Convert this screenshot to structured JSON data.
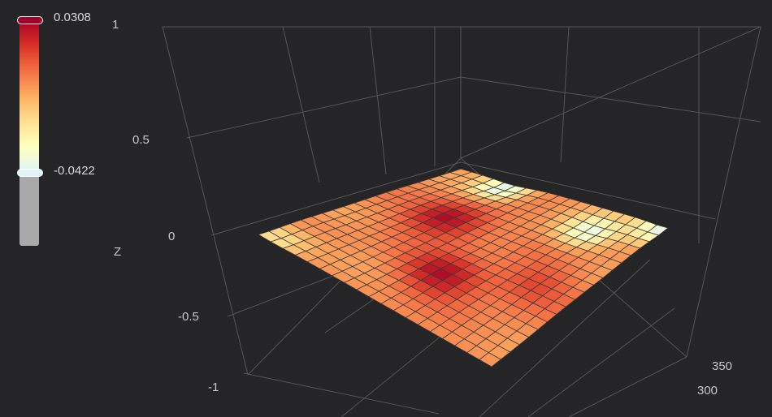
{
  "colorbar": {
    "max_label": "0.0308",
    "min_label": "-0.0422",
    "max_value": 0.0308,
    "min_value": -0.0422,
    "colorscale": [
      "#e0f3f8",
      "#ffffbf",
      "#fee090",
      "#fdae61",
      "#f46d43",
      "#d73027",
      "#a50026"
    ],
    "disabled_color": "#a9a9a9"
  },
  "chart_data": {
    "type": "surface",
    "title": "",
    "z_axis": {
      "label": "Z",
      "range": [
        -1,
        1
      ],
      "ticks": [
        "1",
        "0.5",
        "0",
        "-0.5",
        "-1"
      ]
    },
    "y_axis": {
      "label": "",
      "ticks": [
        "300",
        "350"
      ]
    },
    "x_axis": {
      "label": "",
      "ticks": []
    },
    "grid": true,
    "surface": {
      "rows": 19,
      "cols": 19,
      "z_range": [
        -0.0422,
        0.0308
      ],
      "hotspots": [
        {
          "u": 0.3,
          "v": 0.55,
          "value": 0.028
        },
        {
          "u": 0.62,
          "v": 0.3,
          "value": 0.0308
        },
        {
          "u": 0.45,
          "v": 0.82,
          "value": 0.015
        }
      ],
      "coldspots": [
        {
          "u": 0.95,
          "v": 0.25,
          "value": -0.0422
        },
        {
          "u": 0.85,
          "v": 0.75,
          "value": -0.035
        },
        {
          "u": 0.05,
          "v": 0.05,
          "value": -0.02
        },
        {
          "u": 0.98,
          "v": 0.98,
          "value": -0.04
        }
      ]
    }
  }
}
